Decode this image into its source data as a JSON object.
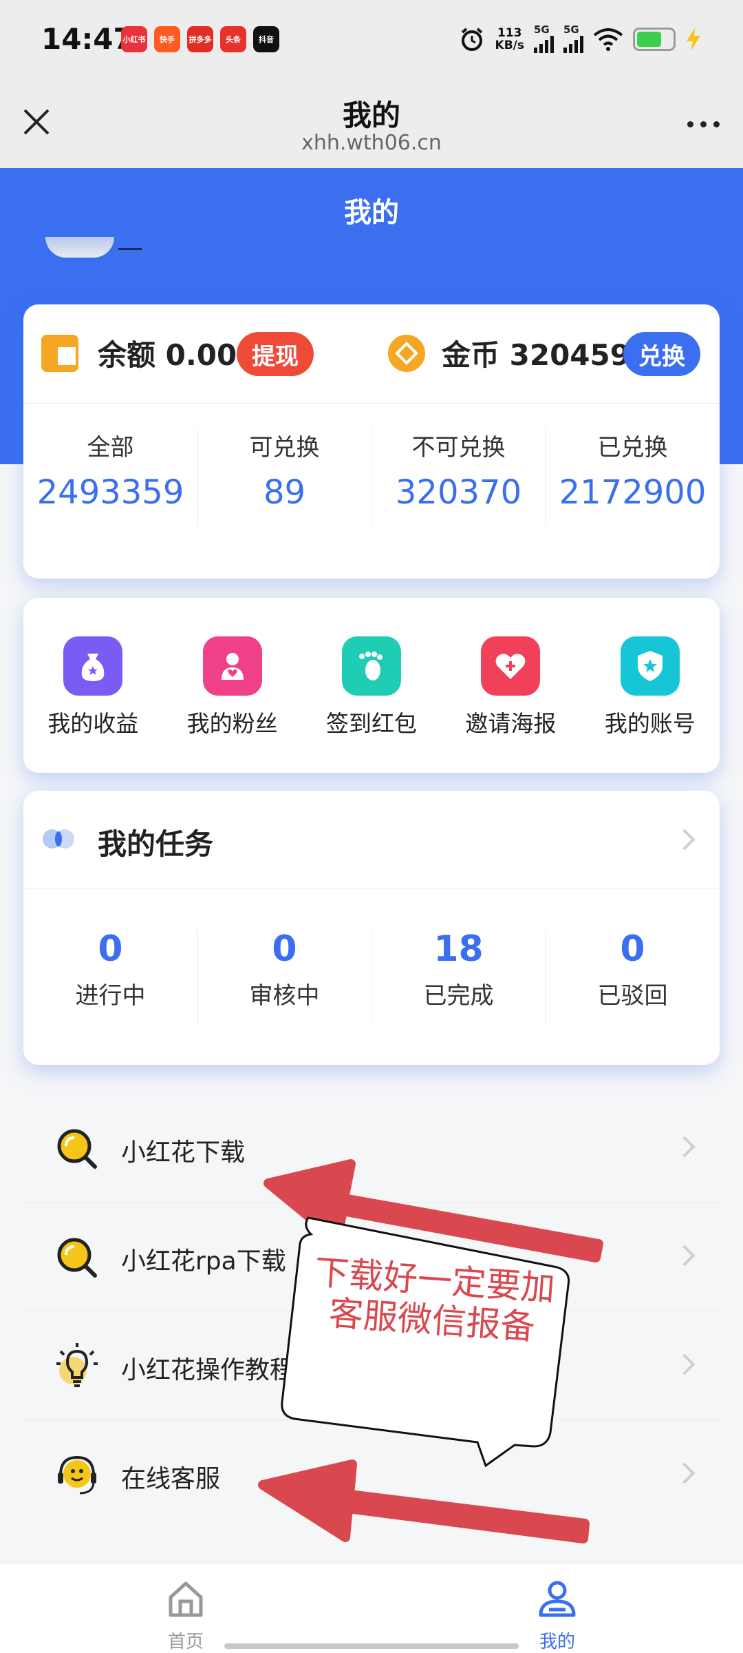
{
  "status_bar": {
    "time": "14:47",
    "apps": [
      {
        "label": "小红书",
        "color": "#e8323c"
      },
      {
        "label": "快手",
        "color": "#ff5a1f"
      },
      {
        "label": "拼多多",
        "color": "#e02e24"
      },
      {
        "label": "头条",
        "color": "#e7312b"
      },
      {
        "label": "抖音",
        "color": "#111111"
      }
    ],
    "speed_value": "113",
    "speed_unit": "KB/s",
    "signal_1": "5G",
    "signal_2": "5G"
  },
  "browser": {
    "title": "我的",
    "url": "xhh.wth06.cn"
  },
  "hero": {
    "title": "我的"
  },
  "balance": {
    "balance_label": "余额 0.00",
    "withdraw_label": "提现",
    "coins_label": "金币 320459",
    "exchange_label": "兑换",
    "stats": [
      {
        "label": "全部",
        "value": "2493359"
      },
      {
        "label": "可兑换",
        "value": "89"
      },
      {
        "label": "不可兑换",
        "value": "320370"
      },
      {
        "label": "已兑换",
        "value": "2172900"
      }
    ]
  },
  "shortcuts": [
    {
      "label": "我的收益",
      "icon": "money-bag-icon",
      "color": "#7a5cf5"
    },
    {
      "label": "我的粉丝",
      "icon": "fans-icon",
      "color": "#f0408a"
    },
    {
      "label": "签到红包",
      "icon": "footprint-icon",
      "color": "#1fcdb4"
    },
    {
      "label": "邀请海报",
      "icon": "heart-plus-icon",
      "color": "#f0405a"
    },
    {
      "label": "我的账号",
      "icon": "shield-star-icon",
      "color": "#17c6d6"
    }
  ],
  "tasks": {
    "title": "我的任务",
    "stats": [
      {
        "value": "0",
        "label": "进行中"
      },
      {
        "value": "0",
        "label": "审核中"
      },
      {
        "value": "18",
        "label": "已完成"
      },
      {
        "value": "0",
        "label": "已驳回"
      }
    ]
  },
  "menu": [
    {
      "label": "小红花下载",
      "icon": "search-icon"
    },
    {
      "label": "小红花rpa下载",
      "icon": "search-icon"
    },
    {
      "label": "小红花操作教程",
      "icon": "lightbulb-icon"
    },
    {
      "label": "在线客服",
      "icon": "headset-icon"
    }
  ],
  "annotation": {
    "text": "下载好一定要加客服微信报备"
  },
  "bottom_nav": {
    "home_label": "首页",
    "mine_label": "我的",
    "active_color": "#3b6ff0",
    "inactive_color": "#999999"
  }
}
